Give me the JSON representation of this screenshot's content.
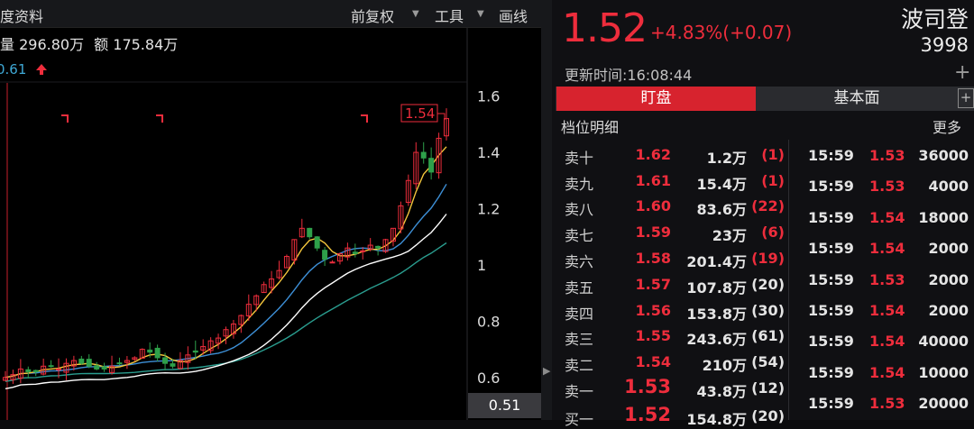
{
  "toolbar": {
    "title": "度资料",
    "adjust_label": "前复权",
    "tools_label": "工具",
    "draw_label": "画线"
  },
  "stats": {
    "volume": "量 296.80万",
    "amount": "额 175.84万"
  },
  "ma_value": "0.61",
  "chart_data": {
    "type": "candlestick",
    "ylim": [
      0.5,
      1.65
    ],
    "yticks": [
      "1.6",
      "1.4",
      "1.2",
      "1",
      "0.8",
      "0.6"
    ],
    "ytick_values": [
      1.6,
      1.4,
      1.2,
      1.0,
      0.8,
      0.6
    ],
    "high_label": "1.54",
    "current_label": "0.51",
    "ma_colors": {
      "ma5": "#f5c63c",
      "ma10": "#ffffff",
      "ma20": "#3d8fd6",
      "ma60": "#2a9d8f"
    },
    "up_color": "#ee2d3c",
    "down_color": "#2ea04a",
    "series_close_approx": [
      0.6,
      0.61,
      0.63,
      0.62,
      0.62,
      0.64,
      0.64,
      0.63,
      0.65,
      0.66,
      0.65,
      0.64,
      0.63,
      0.63,
      0.64,
      0.65,
      0.66,
      0.67,
      0.7,
      0.69,
      0.67,
      0.65,
      0.64,
      0.66,
      0.68,
      0.69,
      0.71,
      0.73,
      0.74,
      0.77,
      0.79,
      0.82,
      0.86,
      0.89,
      0.93,
      0.95,
      0.98,
      1.03,
      1.09,
      1.13,
      1.1,
      1.06,
      1.02,
      1.01,
      1.04,
      1.06,
      1.04,
      1.05,
      1.07,
      1.06,
      1.09,
      1.13,
      1.21,
      1.3,
      1.4,
      1.38,
      1.33,
      1.45,
      1.52
    ]
  },
  "quote": {
    "price": "1.52",
    "change": "+4.83%(+0.07)",
    "name": "波司登",
    "code": "3998",
    "update_time": "更新时间:16:08:44"
  },
  "tabs": {
    "active": "盯盘",
    "fundamentals": "基本面"
  },
  "orderbook_title": "档位明细",
  "more_label": "更多",
  "orderbook": [
    {
      "label": "卖十",
      "price": "1.62",
      "volume": "1.2万",
      "count": "(1)",
      "count_red": true
    },
    {
      "label": "卖九",
      "price": "1.61",
      "volume": "15.4万",
      "count": "(1)",
      "count_red": true
    },
    {
      "label": "卖八",
      "price": "1.60",
      "volume": "83.6万",
      "count": "(22)",
      "count_red": true
    },
    {
      "label": "卖七",
      "price": "1.59",
      "volume": "23万",
      "count": "(6)",
      "count_red": true
    },
    {
      "label": "卖六",
      "price": "1.58",
      "volume": "201.4万",
      "count": "(19)",
      "count_red": true
    },
    {
      "label": "卖五",
      "price": "1.57",
      "volume": "107.8万",
      "count": "(20)",
      "count_red": false
    },
    {
      "label": "卖四",
      "price": "1.56",
      "volume": "153.8万",
      "count": "(30)",
      "count_red": false
    },
    {
      "label": "卖三",
      "price": "1.55",
      "volume": "243.6万",
      "count": "(61)",
      "count_red": false
    },
    {
      "label": "卖二",
      "price": "1.54",
      "volume": "210万",
      "count": "(54)",
      "count_red": false
    },
    {
      "label": "卖一",
      "price": "1.53",
      "volume": "43.8万",
      "count": "(12)",
      "count_red": false
    },
    {
      "label": "买一",
      "price": "1.52",
      "volume": "154.8万",
      "count": "(20)",
      "count_red": false
    }
  ],
  "trades": [
    {
      "time": "15:59",
      "price": "1.53",
      "volume": "36000"
    },
    {
      "time": "15:59",
      "price": "1.53",
      "volume": "4000"
    },
    {
      "time": "15:59",
      "price": "1.54",
      "volume": "18000"
    },
    {
      "time": "15:59",
      "price": "1.54",
      "volume": "2000"
    },
    {
      "time": "15:59",
      "price": "1.53",
      "volume": "2000"
    },
    {
      "time": "15:59",
      "price": "1.54",
      "volume": "2000"
    },
    {
      "time": "15:59",
      "price": "1.54",
      "volume": "40000"
    },
    {
      "time": "15:59",
      "price": "1.54",
      "volume": "10000"
    },
    {
      "time": "15:59",
      "price": "1.53",
      "volume": "20000"
    }
  ]
}
